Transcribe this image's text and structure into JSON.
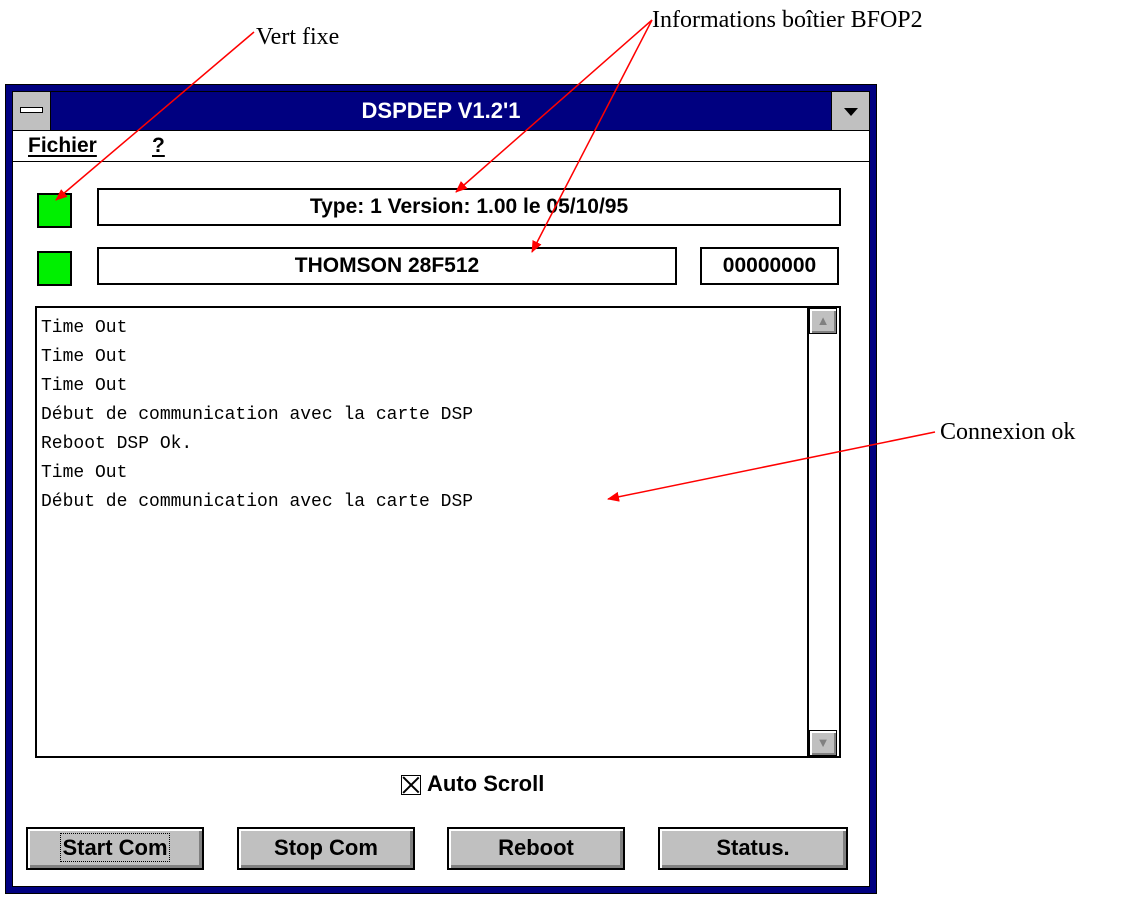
{
  "annotations": {
    "vert_fixe": "Vert fixe",
    "informations": "Informations boîtier BFOP2",
    "connexion": "Connexion ok"
  },
  "window": {
    "title": "DSPDEP V1.2'1"
  },
  "menu": {
    "items": [
      {
        "label": "Fichier"
      },
      {
        "label": "?"
      }
    ]
  },
  "status": {
    "type_version": "Type: 1 Version:  1.00 le 05/10/95",
    "chip": "THOMSON 28F512",
    "counter": "00000000"
  },
  "log": {
    "lines": [
      "Time Out",
      "Time Out",
      "Time Out",
      "Début de communication avec la carte DSP",
      "Reboot DSP Ok.",
      "Time Out",
      "Début de communication avec la carte DSP"
    ]
  },
  "options": {
    "auto_scroll_label": "Auto Scroll",
    "auto_scroll_checked": true
  },
  "buttons": {
    "start": "Start Com",
    "stop": "Stop Com",
    "reboot": "Reboot",
    "status": "Status."
  },
  "colors": {
    "titlebar": "#000080",
    "led": "#00f000",
    "arrow": "#ff0000",
    "button_face": "#c0c0c0"
  }
}
